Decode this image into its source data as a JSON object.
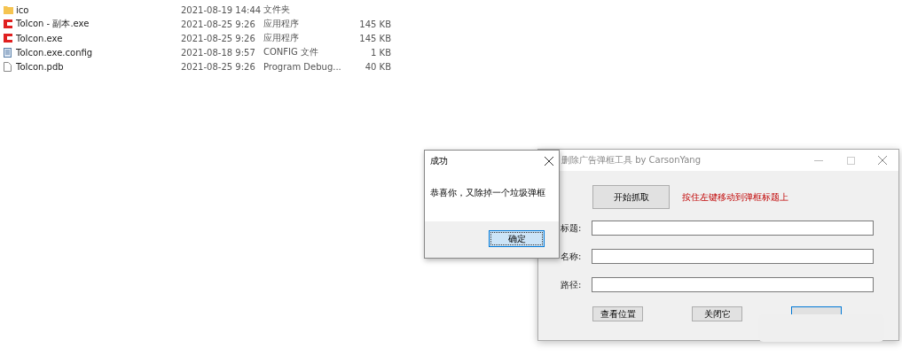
{
  "files": [
    {
      "name": "ico",
      "modified": "2021-08-19 14:44",
      "type": "文件夹",
      "kind": "folder"
    },
    {
      "name": "ToIcon - 副本.exe",
      "modified": "2021-08-25 9:26",
      "type": "应用程序",
      "size": "145 KB",
      "kind": "app"
    },
    {
      "name": "ToIcon.exe",
      "modified": "2021-08-25 9:26",
      "type": "应用程序",
      "size": "145 KB",
      "kind": "app"
    },
    {
      "name": "ToIcon.exe.config",
      "modified": "2021-08-18 9:57",
      "type": "CONFIG 文件",
      "size": "1 KB",
      "kind": "config"
    },
    {
      "name": "ToIcon.pdb",
      "modified": "2021-08-25 9:26",
      "type": "Program Debug...",
      "size": "40 KB",
      "kind": "file"
    }
  ],
  "main_window": {
    "title": "删除广告弹框工具 by CarsonYang",
    "start_button": "开始抓取",
    "hint": "按住左键移动到弹框标题上",
    "fields": [
      {
        "label": "标题:"
      },
      {
        "label": "名称:"
      },
      {
        "label": "路径:"
      }
    ],
    "buttons": [
      {
        "label": "查看位置",
        "focused": false
      },
      {
        "label": "关闭它",
        "focused": false
      },
      {
        "focused": true
      }
    ]
  },
  "dialog": {
    "title": "成功",
    "message": "恭喜你，又除掉一个垃圾弹框",
    "ok_button": "确定"
  }
}
